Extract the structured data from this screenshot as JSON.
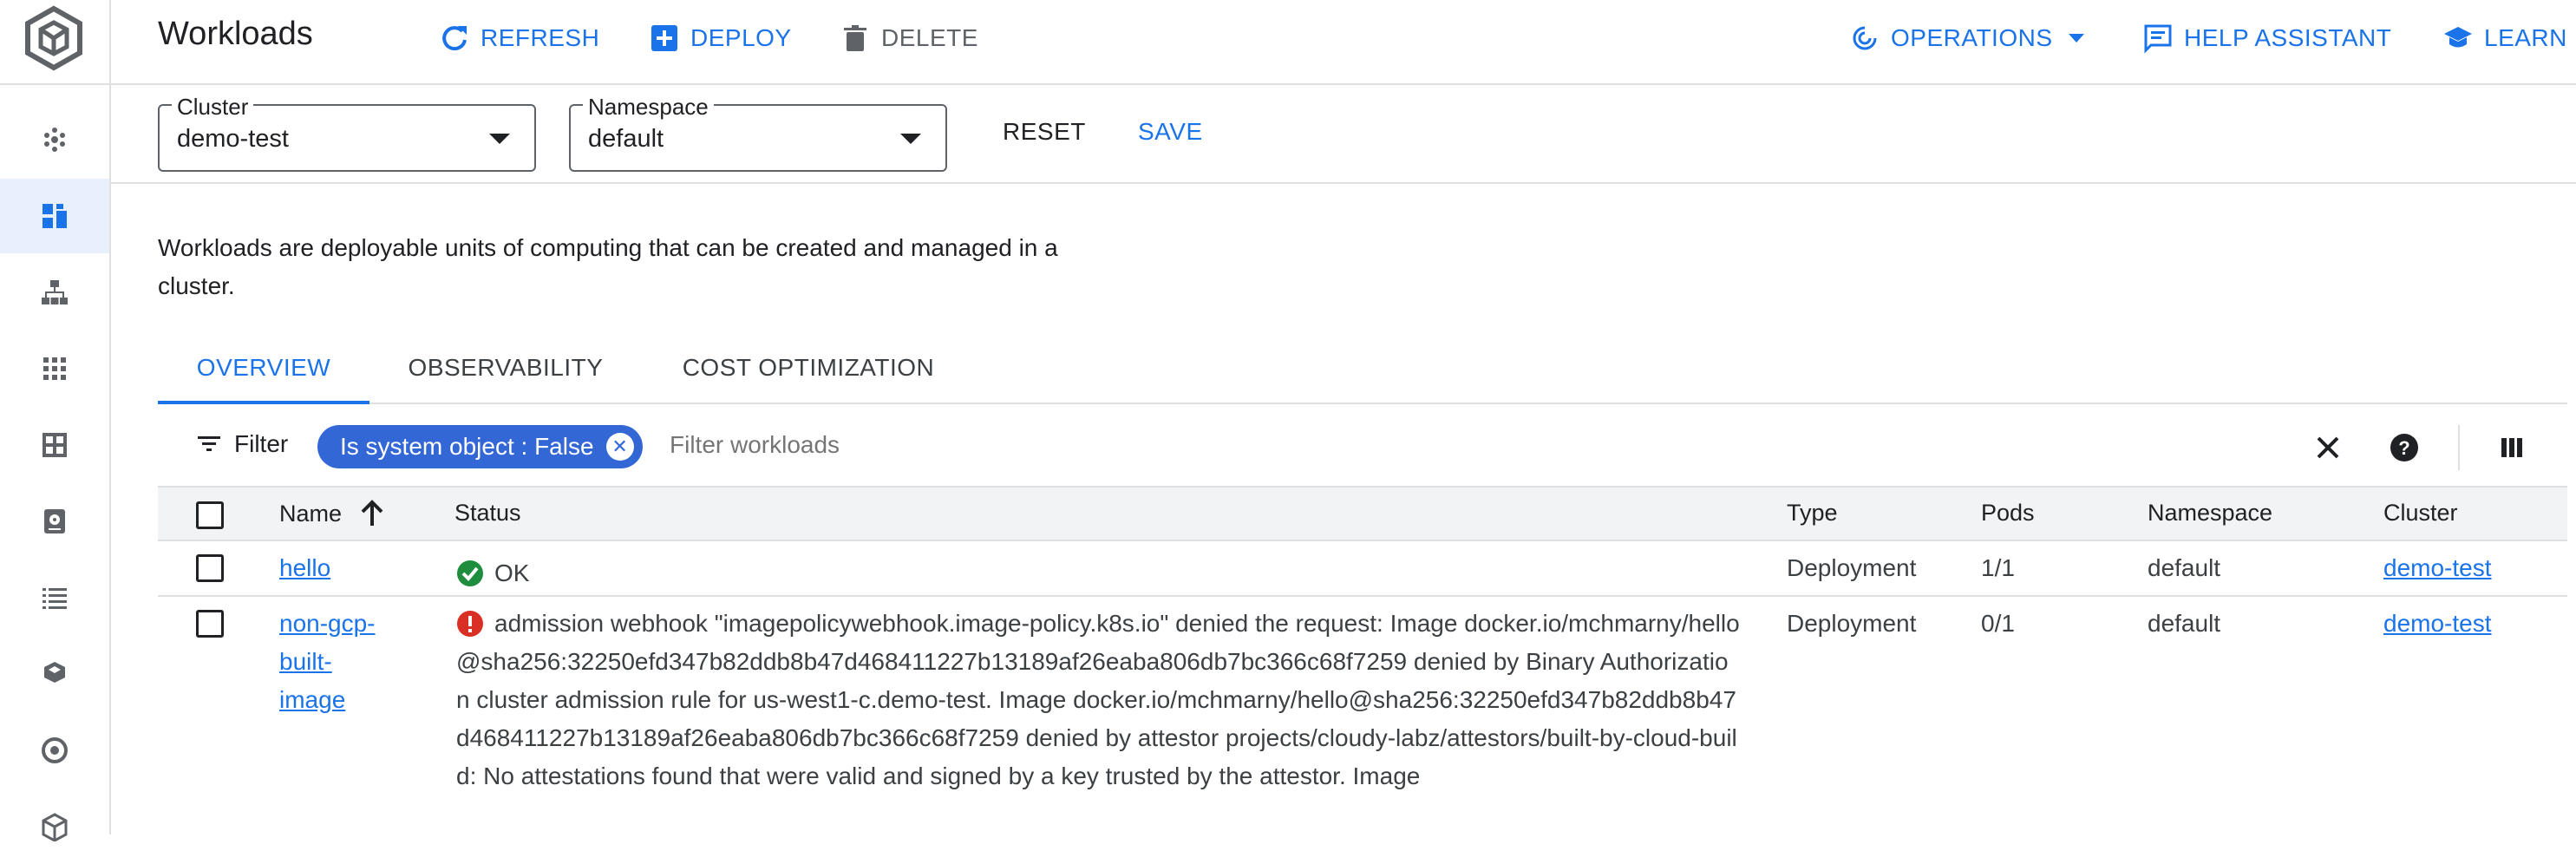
{
  "header": {
    "title": "Workloads",
    "actions": {
      "refresh": "REFRESH",
      "deploy": "DEPLOY",
      "delete": "DELETE",
      "operations": "OPERATIONS",
      "help_assistant": "HELP ASSISTANT",
      "learn": "LEARN"
    }
  },
  "filters": {
    "cluster": {
      "label": "Cluster",
      "value": "demo-test"
    },
    "namespace": {
      "label": "Namespace",
      "value": "default"
    },
    "reset": "RESET",
    "save": "SAVE"
  },
  "description": "Workloads are deployable units of computing that can be created and managed in a cluster.",
  "tabs": [
    {
      "label": "OVERVIEW",
      "active": true
    },
    {
      "label": "OBSERVABILITY",
      "active": false
    },
    {
      "label": "COST OPTIMIZATION",
      "active": false
    }
  ],
  "filterbar": {
    "label": "Filter",
    "chip": "Is system object : False",
    "placeholder": "Filter workloads"
  },
  "table": {
    "columns": [
      "Name",
      "Status",
      "Type",
      "Pods",
      "Namespace",
      "Cluster"
    ],
    "rows": [
      {
        "name": "hello",
        "status": "OK",
        "status_kind": "ok",
        "type": "Deployment",
        "pods": "1/1",
        "namespace": "default",
        "cluster": "demo-test"
      },
      {
        "name": "non-gcp-built-image",
        "name_lines": [
          "non-gcp-",
          "built-",
          "image"
        ],
        "status": "admission webhook \"imagepolicywebhook.image-policy.k8s.io\" denied the request: Image docker.io/mchmarny/hello@sha256:32250efd347b82ddb8b47d468411227b13189af26eaba806db7bc366c68f7259 denied by Binary Authorization cluster admission rule for us-west1-c.demo-test. Image docker.io/mchmarny/hello@sha256:32250efd347b82ddb8b47d468411227b13189af26eaba806db7bc366c68f7259 denied by attestor projects/cloudy-labz/attestors/built-by-cloud-build: No attestations found that were valid and signed by a key trusted by the attestor. Image",
        "status_kind": "error",
        "type": "Deployment",
        "pods": "0/1",
        "namespace": "default",
        "cluster": "demo-test"
      }
    ]
  },
  "colors": {
    "accent": "#1a73e8",
    "chip": "#3367d6",
    "ok": "#1e8e3e",
    "error": "#d93025"
  }
}
